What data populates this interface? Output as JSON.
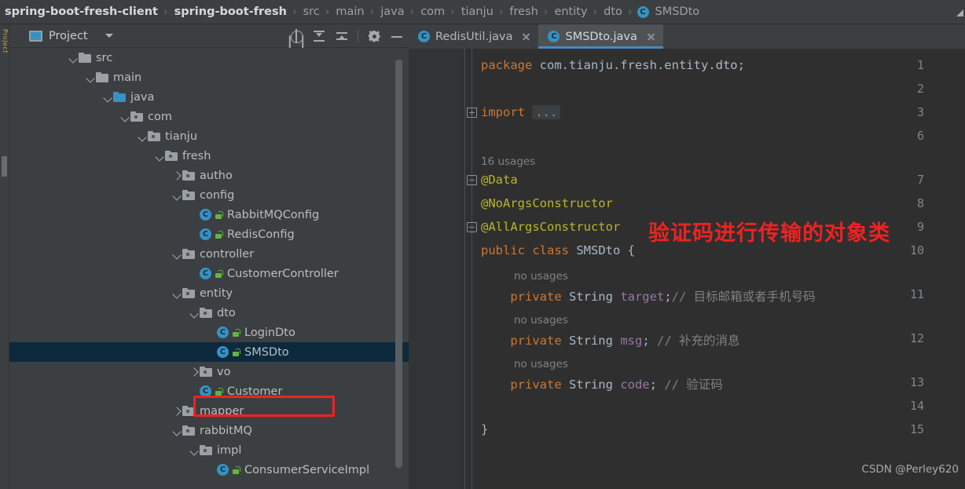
{
  "breadcrumb": {
    "separator": "›",
    "items": [
      {
        "label": "spring-boot-fresh-client",
        "bold": true,
        "icon": null
      },
      {
        "label": "spring-boot-fresh",
        "bold": true,
        "icon": null
      },
      {
        "label": "src",
        "bold": false,
        "icon": null
      },
      {
        "label": "main",
        "bold": false,
        "icon": null
      },
      {
        "label": "java",
        "bold": false,
        "icon": null
      },
      {
        "label": "com",
        "bold": false,
        "icon": null
      },
      {
        "label": "tianju",
        "bold": false,
        "icon": null
      },
      {
        "label": "fresh",
        "bold": false,
        "icon": null
      },
      {
        "label": "entity",
        "bold": false,
        "icon": null
      },
      {
        "label": "dto",
        "bold": false,
        "icon": null
      },
      {
        "label": "SMSDto",
        "bold": false,
        "icon": "class-icon"
      }
    ]
  },
  "left_strip": {
    "project_tab_label": "Project"
  },
  "project_panel": {
    "title": "Project",
    "window_icon": "project-window-icon",
    "dropdown_icon": "chevron-down-icon",
    "toolbar_icons": [
      {
        "name": "locate-icon",
        "title": "Select Opened File"
      },
      {
        "name": "expand-all-icon",
        "title": "Expand All"
      },
      {
        "name": "collapse-all-icon",
        "title": "Collapse All"
      },
      {
        "name": "settings-gear-icon",
        "title": "Settings"
      },
      {
        "name": "minimize-icon",
        "title": "Hide"
      }
    ],
    "tree": [
      {
        "label": "src",
        "indent": 3,
        "arrow": "down",
        "icon": "folder",
        "selected": false
      },
      {
        "label": "main",
        "indent": 4,
        "arrow": "down",
        "icon": "folder",
        "selected": false
      },
      {
        "label": "java",
        "indent": 5,
        "arrow": "down",
        "icon": "folder-source",
        "selected": false
      },
      {
        "label": "com",
        "indent": 6,
        "arrow": "down",
        "icon": "folder-package",
        "selected": false
      },
      {
        "label": "tianju",
        "indent": 7,
        "arrow": "down",
        "icon": "folder-package",
        "selected": false
      },
      {
        "label": "fresh",
        "indent": 8,
        "arrow": "down",
        "icon": "folder-package",
        "selected": false
      },
      {
        "label": "autho",
        "indent": 9,
        "arrow": "right",
        "icon": "folder-package",
        "selected": false
      },
      {
        "label": "config",
        "indent": 9,
        "arrow": "down",
        "icon": "folder-package",
        "selected": false
      },
      {
        "label": "RabbitMQConfig",
        "indent": 10,
        "arrow": "none",
        "icon": "class",
        "selected": false
      },
      {
        "label": "RedisConfig",
        "indent": 10,
        "arrow": "none",
        "icon": "class",
        "selected": false
      },
      {
        "label": "controller",
        "indent": 9,
        "arrow": "down",
        "icon": "folder-package",
        "selected": false
      },
      {
        "label": "CustomerController",
        "indent": 10,
        "arrow": "none",
        "icon": "class",
        "selected": false
      },
      {
        "label": "entity",
        "indent": 9,
        "arrow": "down",
        "icon": "folder-package",
        "selected": false
      },
      {
        "label": "dto",
        "indent": 10,
        "arrow": "down",
        "icon": "folder-package",
        "selected": false
      },
      {
        "label": "LoginDto",
        "indent": 11,
        "arrow": "none",
        "icon": "class",
        "selected": false
      },
      {
        "label": "SMSDto",
        "indent": 11,
        "arrow": "none",
        "icon": "class",
        "selected": true
      },
      {
        "label": "vo",
        "indent": 10,
        "arrow": "right",
        "icon": "folder-package",
        "selected": false
      },
      {
        "label": "Customer",
        "indent": 10,
        "arrow": "none",
        "icon": "class",
        "selected": false
      },
      {
        "label": "mapper",
        "indent": 9,
        "arrow": "right",
        "icon": "folder-package",
        "selected": false
      },
      {
        "label": "rabbitMQ",
        "indent": 9,
        "arrow": "down",
        "icon": "folder-package",
        "selected": false
      },
      {
        "label": "impl",
        "indent": 10,
        "arrow": "down",
        "icon": "folder-package",
        "selected": false
      },
      {
        "label": "ConsumerServiceImpl",
        "indent": 11,
        "arrow": "none",
        "icon": "class",
        "selected": false
      }
    ],
    "annotation_box_color": "#f02222"
  },
  "editor": {
    "tabs": [
      {
        "label": "RedisUtil.java",
        "active": false,
        "icon": "class-icon",
        "close": "close-icon"
      },
      {
        "label": "SMSDto.java",
        "active": true,
        "icon": "class-icon",
        "close": "close-icon"
      }
    ],
    "active_tab_underline_color": "#4a88c7",
    "line_numbers": [
      "1",
      "2",
      "3",
      "6",
      "7",
      "8",
      "9",
      "10",
      "11",
      "12",
      "13",
      "14",
      "15"
    ],
    "code_lines": [
      {
        "num": "1",
        "tokens": [
          {
            "t": "package ",
            "c": "kw"
          },
          {
            "t": "com.tianju.fresh.entity.dto;",
            "c": "ident"
          }
        ]
      },
      {
        "num": "2",
        "tokens": []
      },
      {
        "num": "3",
        "tokens": [
          {
            "t": "import ",
            "c": "kw"
          },
          {
            "t": "...",
            "c": "folded"
          }
        ]
      },
      {
        "num": "6",
        "tokens": []
      },
      {
        "num": "7",
        "tokens": [
          {
            "t": "@Data",
            "c": "ann"
          }
        ]
      },
      {
        "num": "8",
        "tokens": [
          {
            "t": "@NoArgsConstructor",
            "c": "ann"
          }
        ]
      },
      {
        "num": "9",
        "tokens": [
          {
            "t": "@AllArgsConstructor",
            "c": "ann"
          }
        ]
      },
      {
        "num": "10",
        "tokens": [
          {
            "t": "public class ",
            "c": "kw"
          },
          {
            "t": "SMSDto",
            "c": "cls-nm"
          },
          {
            "t": " {",
            "c": "punct"
          }
        ]
      },
      {
        "num": "11",
        "tokens": [
          {
            "t": "    private ",
            "c": "kw"
          },
          {
            "t": "String ",
            "c": "ident"
          },
          {
            "t": "target",
            "c": "field"
          },
          {
            "t": ";",
            "c": "punct"
          },
          {
            "t": "// 目标邮箱或者手机号码",
            "c": "cmt"
          }
        ]
      },
      {
        "num": "12",
        "tokens": [
          {
            "t": "    private ",
            "c": "kw"
          },
          {
            "t": "String ",
            "c": "ident"
          },
          {
            "t": "msg",
            "c": "field"
          },
          {
            "t": "; ",
            "c": "punct"
          },
          {
            "t": "// 补充的消息",
            "c": "cmt"
          }
        ]
      },
      {
        "num": "13",
        "tokens": [
          {
            "t": "    private ",
            "c": "kw"
          },
          {
            "t": "String ",
            "c": "ident"
          },
          {
            "t": "code",
            "c": "field"
          },
          {
            "t": "; ",
            "c": "punct"
          },
          {
            "t": "// 验证码",
            "c": "cmt"
          }
        ]
      },
      {
        "num": "14",
        "tokens": []
      },
      {
        "num": "15",
        "tokens": [
          {
            "t": "}",
            "c": "punct"
          }
        ]
      }
    ],
    "usage_hints": [
      {
        "text": "16 usages",
        "indent": 0
      },
      {
        "text": "no usages",
        "indent": 1
      },
      {
        "text": "no usages",
        "indent": 1
      },
      {
        "text": "no usages",
        "indent": 1
      }
    ],
    "fold_markers": [
      {
        "type": "plus",
        "line": "3"
      },
      {
        "type": "top",
        "line": "7"
      },
      {
        "type": "bottom",
        "line": "9"
      }
    ],
    "annotation_text": "验证码进行传输的对象类",
    "annotation_color": "#ee2222",
    "watermark": "CSDN @Perley620"
  }
}
